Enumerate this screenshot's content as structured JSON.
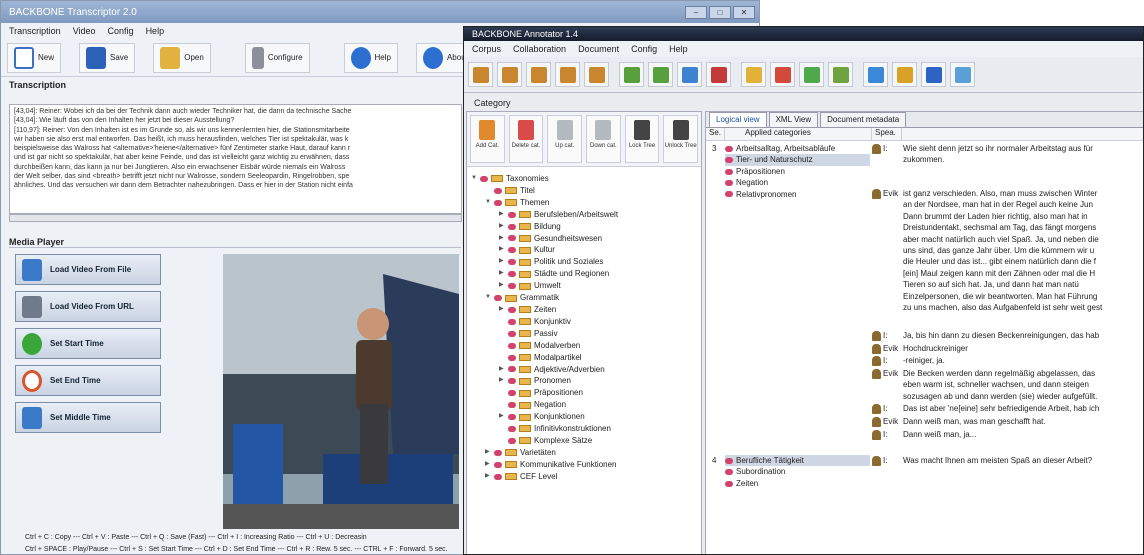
{
  "transcriptor": {
    "title": "BACKBONE Transcriptor 2.0",
    "menu": [
      "Transcription",
      "Video",
      "Config",
      "Help"
    ],
    "toolbar": [
      {
        "label": "New",
        "icon": "new-file-icon",
        "color": "#3d6fc4"
      },
      {
        "label": "Save",
        "icon": "save-icon",
        "color": "#2c62b8"
      },
      {
        "label": "Open",
        "icon": "open-folder-icon",
        "color": "#e2b240"
      },
      {
        "label": "Configure",
        "icon": "wrench-icon",
        "color": "#8a8f99"
      },
      {
        "label": "Help",
        "icon": "help-icon",
        "color": "#2d6fd0"
      },
      {
        "label": "About",
        "icon": "about-icon",
        "color": "#2d6fd0"
      }
    ],
    "transcription_label": "Transcription",
    "transcript_lines": [
      "[43,04]: Reiner: Wobei ich da bei der Technik dann auch wieder Techniker hat, die dann da technische Sache",
      "[43,04]: Wie läuft das von den Inhalten her jetzt bei dieser Ausstellung?",
      "[110,97]: Reiner: Von den Inhalten ist es im Grunde so, als wir uns kennenlernten hier, die Stationsmitarbeite",
      "wir haben sie also erst mal entworfen. Das heißt, ich muss herausfinden, welches Tier ist spektakulär, was k",
      "beispielsweise das Walross hat <alternative>'heiene</alternative> fünf Zentimeter starke Haut, darauf kann r",
      "und ist gar nicht so spektakulär, hat aber keine Feinde, und das ist vielleicht ganz wichtig zu erwähnen, dass",
      "durchbeißen kann, das kann ja nur bei Jungtieren. Also ein erwachsener Eisbär würde niemals ein Walross",
      "der Welt selber, das sind <breath> betrifft jetzt nicht nur Walrosse, sondern Seeleopardin, Ringelrobben, spe",
      "ähnliches. Und das versuchen wir dann dem Betrachter nahezubringen. Dass er hier in der Station nicht einfa"
    ],
    "media_player_label": "Media Player",
    "media_buttons": [
      {
        "label": "Load Video From File",
        "icon": "film-file-icon",
        "color": "#3b79c9"
      },
      {
        "label": "Load Video From URL",
        "icon": "film-url-icon",
        "color": "#6f7a8a"
      },
      {
        "label": "Set Start Time",
        "icon": "play-circle-icon",
        "color": "#3aa63a"
      },
      {
        "label": "Set End Time",
        "icon": "stop-circle-icon",
        "color": "#d9532b"
      },
      {
        "label": "Set Middle Time",
        "icon": "pencil-note-icon",
        "color": "#3b79c9"
      }
    ],
    "shortcuts": [
      "Ctrl + C : Copy --- Ctrl + V : Paste --- Ctrl + Q : Save (Fast) --- Ctrl + I : Increasing Ratio --- Ctrl + U : Decreasin",
      "Ctrl + SPACE : Play/Pause --- Ctrl + S : Set Start Time --- Ctrl + D : Set End Time --- Ctrl + R : Rew. 5 sec. --- CTRL + F : Forward. 5 sec."
    ]
  },
  "annotator": {
    "title": "BACKBONE Annotator 1.4",
    "menu": [
      "Corpus",
      "Collaboration",
      "Document",
      "Config",
      "Help"
    ],
    "toolbar_icons": [
      {
        "icon": "corpus-add-icon",
        "color": "#c9862e"
      },
      {
        "icon": "corpus-remove-icon",
        "color": "#c9862e"
      },
      {
        "icon": "corpus-open-icon",
        "color": "#c9862e"
      },
      {
        "icon": "corpus-save-icon",
        "color": "#c9862e"
      },
      {
        "icon": "corpus-export-icon",
        "color": "#c9862e"
      },
      {
        "icon": "tag-green-icon",
        "color": "#58a03c"
      },
      {
        "icon": "tag-green-2-icon",
        "color": "#58a03c"
      },
      {
        "icon": "tag-blue-icon",
        "color": "#3d83d1"
      },
      {
        "icon": "tag-red-icon",
        "color": "#c33a3a"
      },
      {
        "icon": "pencil-icon",
        "color": "#e3b13a"
      },
      {
        "icon": "note-red-icon",
        "color": "#d44a3a"
      },
      {
        "icon": "note-green-icon",
        "color": "#4fa84a"
      },
      {
        "icon": "grid-icon",
        "color": "#6fa33f"
      },
      {
        "icon": "monitor-icon",
        "color": "#3b87d8"
      },
      {
        "icon": "brush-icon",
        "color": "#d8a227"
      },
      {
        "icon": "edit-icon",
        "color": "#2e62c4"
      },
      {
        "icon": "list-icon",
        "color": "#5a9fd6"
      }
    ],
    "category_label": "Category",
    "category_tools": [
      {
        "label": "Add Cat.",
        "icon": "add-category-icon",
        "color": "#e0892e"
      },
      {
        "label": "Delete cat.",
        "icon": "delete-category-icon",
        "color": "#d94a4a"
      },
      {
        "label": "Up cat.",
        "icon": "up-category-icon",
        "color": "#b5b9c0"
      },
      {
        "label": "Down cat.",
        "icon": "down-category-icon",
        "color": "#b5b9c0"
      },
      {
        "label": "Lock Tree",
        "icon": "lock-icon",
        "color": "#444"
      },
      {
        "label": "Unlock Tree",
        "icon": "unlock-icon",
        "color": "#444"
      }
    ],
    "tree": [
      {
        "label": "Taxonomies",
        "level": 0,
        "expanded": true
      },
      {
        "label": "Titel",
        "level": 1
      },
      {
        "label": "Themen",
        "level": 1,
        "expanded": true
      },
      {
        "label": "Berufsleben/Arbeitswelt",
        "level": 2,
        "collapsed": true
      },
      {
        "label": "Bildung",
        "level": 2,
        "collapsed": true
      },
      {
        "label": "Gesundheitswesen",
        "level": 2,
        "collapsed": true
      },
      {
        "label": "Kultur",
        "level": 2,
        "collapsed": true
      },
      {
        "label": "Politik und Soziales",
        "level": 2,
        "collapsed": true
      },
      {
        "label": "Städte und Regionen",
        "level": 2,
        "collapsed": true
      },
      {
        "label": "Umwelt",
        "level": 2,
        "collapsed": true
      },
      {
        "label": "Grammatik",
        "level": 1,
        "expanded": true
      },
      {
        "label": "Zeiten",
        "level": 2,
        "collapsed": true
      },
      {
        "label": "Konjunktiv",
        "level": 2
      },
      {
        "label": "Passiv",
        "level": 2
      },
      {
        "label": "Modalverben",
        "level": 2
      },
      {
        "label": "Modalpartikel",
        "level": 2
      },
      {
        "label": "Adjektive/Adverbien",
        "level": 2,
        "collapsed": true
      },
      {
        "label": "Pronomen",
        "level": 2,
        "collapsed": true
      },
      {
        "label": "Präpositionen",
        "level": 2
      },
      {
        "label": "Negation",
        "level": 2
      },
      {
        "label": "Konjunktionen",
        "level": 2,
        "collapsed": true
      },
      {
        "label": "Infinitivkonstruktionen",
        "level": 2
      },
      {
        "label": "Komplexe Sätze",
        "level": 2
      },
      {
        "label": "Varietäten",
        "level": 1,
        "collapsed": true
      },
      {
        "label": "Kommunikative Funktionen",
        "level": 1,
        "collapsed": true
      },
      {
        "label": "CEF Level",
        "level": 1,
        "collapsed": true
      }
    ],
    "tabs": [
      "Logical view",
      "XML View",
      "Document metadata"
    ],
    "columns": [
      "Se.",
      "Applied categories",
      "Spea."
    ],
    "rows": [
      {
        "num": "3",
        "cats": [
          "Arbeitsalltag, Arbeitsabläufe",
          "Tier- und Naturschutz",
          "Präpositionen",
          "Negation",
          "Relativpronomen"
        ],
        "speaker": "I:",
        "text": "Wie sieht denn jetzt so ihr normaler Arbeitstag aus für\nzukommen."
      },
      {
        "num": "",
        "cats": [],
        "speaker": "Evik",
        "text": "ist ganz verschieden. Also, man muss zwischen Winter\nan der Nordsee, man hat in der Regel auch keine Jun\nDann brummt der Laden hier richtig, also man hat in\nDreistundentakt, sechsmal am Tag, das fängt morgens\naber macht natürlich auch viel Spaß. Ja, und neben die\nuns sind, das ganze Jahr über. Um die kümmern wir u\ndie Heuler und das ist... gibt einem natürlich dann die f\n[ein] Maul zeigen kann mit den Zähnen oder mal die H\nTieren so auf sich hat. Ja, und dann hat man natü\nEinzelpersonen, die wir beantworten. Man hat Führung\nzu uns machen, also das Aufgabenfeld ist sehr weit gest"
      },
      {
        "num": "",
        "cats": [],
        "speaker": "I:",
        "text": "Ja, bis hin dann zu diesen Beckenreinigungen, das hab"
      },
      {
        "num": "",
        "cats": [],
        "speaker": "Evik",
        "text": "Hochdruckreiniger"
      },
      {
        "num": "",
        "cats": [],
        "speaker": "I:",
        "text": "-reiniger, ja."
      },
      {
        "num": "",
        "cats": [],
        "speaker": "Evik",
        "text": "Die Becken werden dann regelmäßig abgelassen, das\neben warm ist, schneller wachsen, und dann steigen\nsozusagen ab und dann werden (sie) wieder aufgefüllt."
      },
      {
        "num": "",
        "cats": [],
        "speaker": "I:",
        "text": "Das ist aber 'ne[eine] sehr befriedigende Arbeit, hab ich"
      },
      {
        "num": "",
        "cats": [],
        "speaker": "Evik",
        "text": "Dann weiß man, was man geschafft hat."
      },
      {
        "num": "",
        "cats": [],
        "speaker": "I:",
        "text": "Dann weiß man, ja..."
      },
      {
        "num": "4",
        "cats": [
          "Berufliche Tätigkeit",
          "Subordination",
          "Zeiten"
        ],
        "speaker": "I:",
        "text": "Was macht Ihnen am meisten Spaß an dieser Arbeit?"
      }
    ]
  }
}
